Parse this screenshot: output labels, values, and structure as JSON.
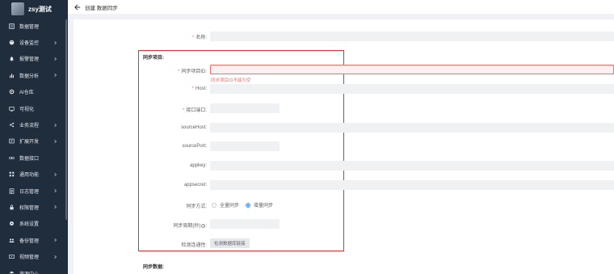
{
  "brand": {
    "name": "zsy测试"
  },
  "nav": [
    {
      "label": "数据管理",
      "icon": "database-icon",
      "chevron": false
    },
    {
      "label": "设备监控",
      "icon": "palette-icon",
      "chevron": true
    },
    {
      "label": "报警管理",
      "icon": "alarm-icon",
      "chevron": true
    },
    {
      "label": "数据分析",
      "icon": "chart-icon",
      "chevron": true
    },
    {
      "label": "AI仓库",
      "icon": "gear-icon",
      "chevron": false
    },
    {
      "label": "可视化",
      "icon": "screen-icon",
      "chevron": false
    },
    {
      "label": "业务流程",
      "icon": "share-icon",
      "chevron": true
    },
    {
      "label": "扩展开发",
      "icon": "dev-icon",
      "chevron": true
    },
    {
      "label": "数据接口",
      "icon": "link-icon",
      "chevron": false
    },
    {
      "label": "通用功能",
      "icon": "grid-icon",
      "chevron": true
    },
    {
      "label": "日志管理",
      "icon": "log-icon",
      "chevron": true
    },
    {
      "label": "权限管理",
      "icon": "lock-icon",
      "chevron": true
    },
    {
      "label": "系统设置",
      "icon": "settings-icon",
      "chevron": false
    },
    {
      "label": "备份管理",
      "icon": "backup-icon",
      "chevron": true
    },
    {
      "label": "视频管理",
      "icon": "video-icon",
      "chevron": true
    },
    {
      "label": "资源中心",
      "icon": "resource-icon",
      "chevron": false
    }
  ],
  "header": {
    "title": "创建 数据同步"
  },
  "form": {
    "name_label": "名称:",
    "sync_section": "同步项目:",
    "project_id_label": "同步项目ID:",
    "project_id_error": "同步项目ID不能为空",
    "host_label": "Host:",
    "port_label": "接口端口:",
    "source_host_label": "sourceHost:",
    "source_port_label": "sourcePort:",
    "appkey_label": "appkey:",
    "appsecret_label": "appsecret:",
    "sync_mode_label": "同步方式:",
    "sync_mode_options": [
      "全量同步",
      "增量同步"
    ],
    "sync_mode_selected": "增量同步",
    "sync_period_label": "同步周期(秒)",
    "sync_period_help": "?",
    "conn_label": "检测连通性:",
    "conn_button": "检测数据库链接",
    "data_section": "同步数据:"
  },
  "colors": {
    "sidebar_bg": "#1f2d3d",
    "error": "#f56c6c",
    "highlight": "#e2312d",
    "accent": "#409eff"
  }
}
